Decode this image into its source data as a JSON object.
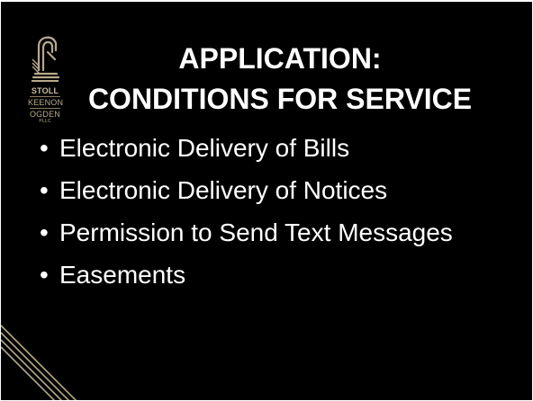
{
  "slide": {
    "title_line1": "APPLICATION:",
    "title_line2": "CONDITIONS FOR SERVICE",
    "bullet_glyph": "•",
    "bullets": [
      "Electronic Delivery of Bills",
      "Electronic Delivery of Notices",
      "Permission to Send Text Messages",
      "Easements"
    ]
  },
  "logo": {
    "line1": "STOLL",
    "line2": "KEENON",
    "line3": "OGDEN",
    "line4": "PLLC",
    "icon": "knight-chess-piece-icon"
  },
  "colors": {
    "background": "#000000",
    "text": "#ffffff",
    "accent_gold": "#b8a98c"
  }
}
